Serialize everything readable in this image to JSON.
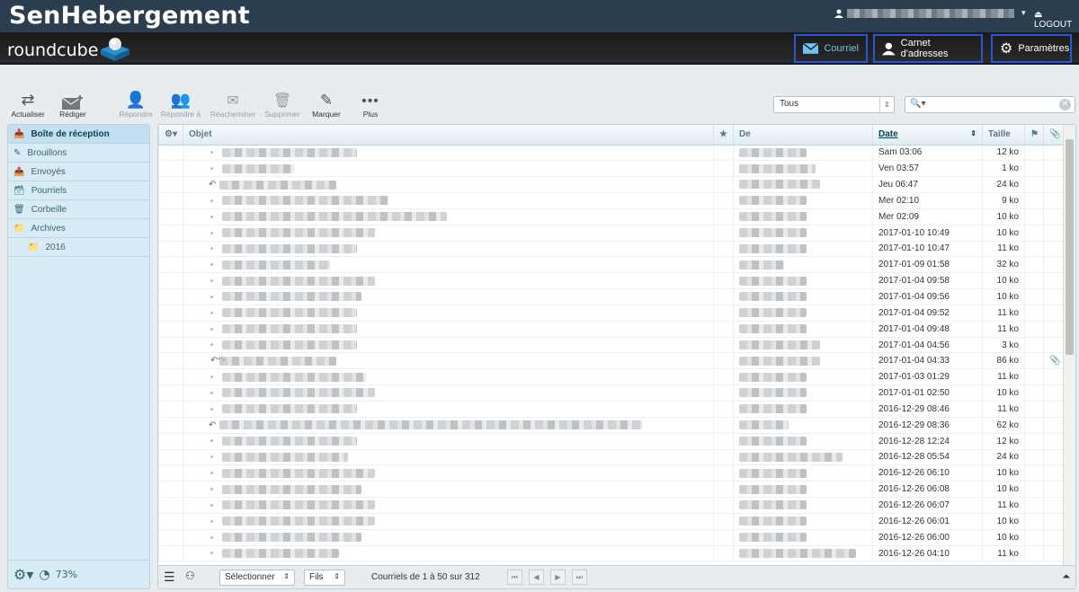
{
  "brand": "SenHebergement",
  "user_caret": "▾",
  "logout_label": "LOGOUT",
  "rc_logo": "roundcube",
  "nav": {
    "mail": "Courriel",
    "addressbook": "Carnet d'adresses",
    "settings": "Paramètres"
  },
  "toolbar": {
    "refresh": "Actualiser",
    "compose": "Rédiger",
    "reply": "Répondre",
    "reply_all": "Répondre à",
    "forward": "Réacheminer",
    "delete": "Supprimer",
    "mark": "Marquer",
    "more": "Plus"
  },
  "filter": {
    "value": "Tous"
  },
  "folders": [
    {
      "label": "Boîte de réception",
      "icon": "inbox-icon"
    },
    {
      "label": "Brouillons",
      "icon": "pencil-icon"
    },
    {
      "label": "Envoyés",
      "icon": "sent-icon"
    },
    {
      "label": "Pourriels",
      "icon": "junk-icon"
    },
    {
      "label": "Corbeille",
      "icon": "trash-icon"
    },
    {
      "label": "Archives",
      "icon": "folder-icon"
    },
    {
      "label": "2016",
      "icon": "folder-icon"
    }
  ],
  "quota": "73%",
  "columns": {
    "subject": "Objet",
    "from": "De",
    "date": "Date",
    "size": "Taille"
  },
  "messages": [
    {
      "date": "Sam 03:06",
      "size": "12 ko",
      "flag": ""
    },
    {
      "date": "Ven 03:57",
      "size": "1 ko",
      "flag": ""
    },
    {
      "date": "Jeu 06:47",
      "size": "24 ko",
      "flag": "reply"
    },
    {
      "date": "Mer 02:10",
      "size": "9 ko",
      "flag": ""
    },
    {
      "date": "Mer 02:09",
      "size": "10 ko",
      "flag": ""
    },
    {
      "date": "2017-01-10 10:49",
      "size": "10 ko",
      "flag": ""
    },
    {
      "date": "2017-01-10 10:47",
      "size": "11 ko",
      "flag": ""
    },
    {
      "date": "2017-01-09 01:58",
      "size": "32 ko",
      "flag": ""
    },
    {
      "date": "2017-01-04 09:58",
      "size": "10 ko",
      "flag": ""
    },
    {
      "date": "2017-01-04 09:56",
      "size": "10 ko",
      "flag": ""
    },
    {
      "date": "2017-01-04 09:52",
      "size": "11 ko",
      "flag": ""
    },
    {
      "date": "2017-01-04 09:48",
      "size": "11 ko",
      "flag": ""
    },
    {
      "date": "2017-01-04 04:56",
      "size": "3 ko",
      "flag": ""
    },
    {
      "date": "2017-01-04 04:33",
      "size": "86 ko",
      "flag": "replyfwd",
      "attach": true
    },
    {
      "date": "2017-01-03 01:29",
      "size": "11 ko",
      "flag": ""
    },
    {
      "date": "2017-01-01 02:50",
      "size": "10 ko",
      "flag": ""
    },
    {
      "date": "2016-12-29 08:46",
      "size": "11 ko",
      "flag": ""
    },
    {
      "date": "2016-12-29 08:36",
      "size": "62 ko",
      "flag": "reply"
    },
    {
      "date": "2016-12-28 12:24",
      "size": "12 ko",
      "flag": ""
    },
    {
      "date": "2016-12-28 05:54",
      "size": "24 ko",
      "flag": ""
    },
    {
      "date": "2016-12-26 06:10",
      "size": "10 ko",
      "flag": ""
    },
    {
      "date": "2016-12-26 06:08",
      "size": "10 ko",
      "flag": ""
    },
    {
      "date": "2016-12-26 06:07",
      "size": "11 ko",
      "flag": ""
    },
    {
      "date": "2016-12-26 06:01",
      "size": "10 ko",
      "flag": ""
    },
    {
      "date": "2016-12-26 06:00",
      "size": "10 ko",
      "flag": ""
    },
    {
      "date": "2016-12-26 04:10",
      "size": "11 ko",
      "flag": ""
    }
  ],
  "footer": {
    "select": "Sélectionner",
    "threads": "Fils",
    "count": "Courriels de 1 à 50 sur 312"
  }
}
